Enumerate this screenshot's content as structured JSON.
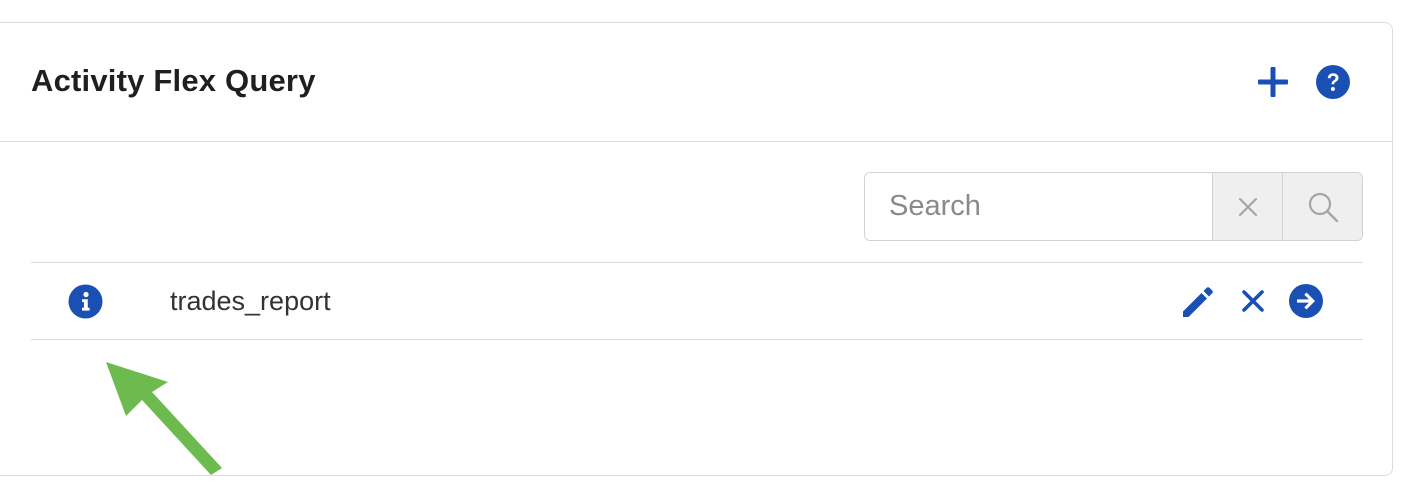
{
  "panel": {
    "title": "Activity Flex Query",
    "add_icon": "plus-icon",
    "help_icon": "question-circle-icon"
  },
  "search": {
    "placeholder": "Search",
    "value": "",
    "clear_icon": "x-icon",
    "submit_icon": "magnifier-icon"
  },
  "queries": [
    {
      "name": "trades_report",
      "info_icon": "info-circle-icon",
      "edit_icon": "pencil-icon",
      "delete_icon": "x-icon",
      "run_icon": "arrow-right-circle-icon"
    }
  ],
  "colors": {
    "accent": "#1a4fb4",
    "annotation_arrow": "#6dbb4f",
    "border": "#dcdcdc",
    "button_bg": "#efefef"
  }
}
